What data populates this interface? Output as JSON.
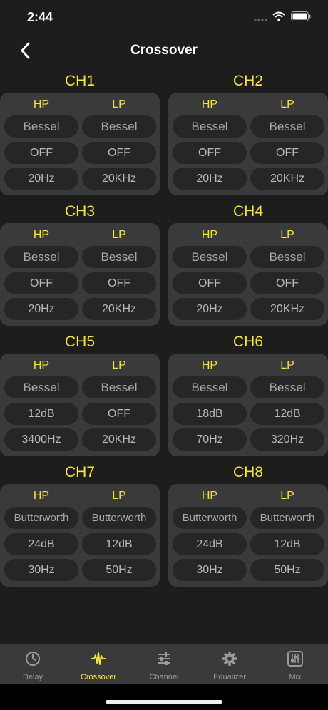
{
  "status": {
    "time": "2:44"
  },
  "nav": {
    "title": "Crossover"
  },
  "labels": {
    "hp": "HP",
    "lp": "LP"
  },
  "channels": [
    {
      "name": "CH1",
      "hp": {
        "type": "Bessel",
        "slope": "OFF",
        "freq": "20Hz"
      },
      "lp": {
        "type": "Bessel",
        "slope": "OFF",
        "freq": "20KHz"
      }
    },
    {
      "name": "CH2",
      "hp": {
        "type": "Bessel",
        "slope": "OFF",
        "freq": "20Hz"
      },
      "lp": {
        "type": "Bessel",
        "slope": "OFF",
        "freq": "20KHz"
      }
    },
    {
      "name": "CH3",
      "hp": {
        "type": "Bessel",
        "slope": "OFF",
        "freq": "20Hz"
      },
      "lp": {
        "type": "Bessel",
        "slope": "OFF",
        "freq": "20KHz"
      }
    },
    {
      "name": "CH4",
      "hp": {
        "type": "Bessel",
        "slope": "OFF",
        "freq": "20Hz"
      },
      "lp": {
        "type": "Bessel",
        "slope": "OFF",
        "freq": "20KHz"
      }
    },
    {
      "name": "CH5",
      "hp": {
        "type": "Bessel",
        "slope": "12dB",
        "freq": "3400Hz"
      },
      "lp": {
        "type": "Bessel",
        "slope": "OFF",
        "freq": "20KHz"
      }
    },
    {
      "name": "CH6",
      "hp": {
        "type": "Bessel",
        "slope": "18dB",
        "freq": "70Hz"
      },
      "lp": {
        "type": "Bessel",
        "slope": "12dB",
        "freq": "320Hz"
      }
    },
    {
      "name": "CH7",
      "hp": {
        "type": "Butterworth",
        "slope": "24dB",
        "freq": "30Hz"
      },
      "lp": {
        "type": "Butterworth",
        "slope": "12dB",
        "freq": "50Hz"
      }
    },
    {
      "name": "CH8",
      "hp": {
        "type": "Butterworth",
        "slope": "24dB",
        "freq": "30Hz"
      },
      "lp": {
        "type": "Butterworth",
        "slope": "12dB",
        "freq": "50Hz"
      }
    }
  ],
  "tabs": [
    {
      "label": "Delay",
      "icon": "clock-icon"
    },
    {
      "label": "Crossover",
      "icon": "waveform-icon",
      "active": true
    },
    {
      "label": "Channel",
      "icon": "sliders-icon"
    },
    {
      "label": "Equalizer",
      "icon": "gear-icon"
    },
    {
      "label": "Mix",
      "icon": "mixer-icon"
    }
  ],
  "colors": {
    "accent": "#f6e33c",
    "background": "#1d1d1d",
    "panel": "#3a3a3a",
    "pill": "#262626"
  }
}
